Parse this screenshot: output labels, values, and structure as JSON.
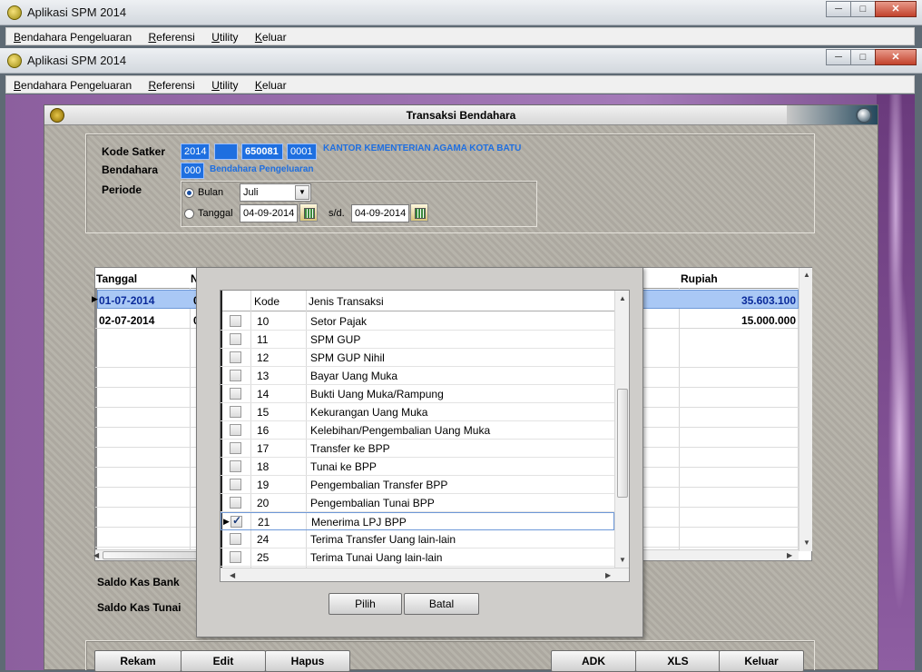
{
  "outer_window": {
    "title": "Aplikasi SPM 2014",
    "menu": [
      "Bendahara Pengeluaran",
      "Referensi",
      "Utility",
      "Keluar"
    ]
  },
  "inner_window": {
    "title": "Aplikasi SPM 2014",
    "menu": [
      "Bendahara Pengeluaran",
      "Referensi",
      "Utility",
      "Keluar"
    ]
  },
  "form": {
    "title": "Transaksi Bendahara",
    "kode_satker_label": "Kode Satker",
    "kode_satker": [
      "2014",
      "",
      "650081",
      "0001"
    ],
    "satker_name": "KANTOR KEMENTERIAN AGAMA KOTA BATU",
    "bendahara_label": "Bendahara",
    "bendahara_code": "000",
    "bendahara_name": "Bendahara Pengeluaran",
    "periode_label": "Periode",
    "bulan_label": "Bulan",
    "bulan_value": "Juli",
    "tanggal_label": "Tanggal",
    "tanggal_from": "04-09-2014",
    "sd_label": "s/d.",
    "tanggal_to": "04-09-2014"
  },
  "grid": {
    "columns": [
      "Tanggal",
      "N",
      "Rupiah"
    ],
    "rows": [
      {
        "tanggal": "01-07-2014",
        "n": "0",
        "rupiah": "35.603.100"
      },
      {
        "tanggal": "02-07-2014",
        "n": "0",
        "rupiah": "15.000.000"
      }
    ]
  },
  "saldo": {
    "bank_label": "Saldo Kas Bank",
    "tunai_label": "Saldo Kas Tunai"
  },
  "buttons": {
    "rekam": "Rekam",
    "edit": "Edit",
    "hapus": "Hapus",
    "adk": "ADK",
    "xls": "XLS",
    "keluar": "Keluar"
  },
  "dialog": {
    "col_kode": "Kode",
    "col_jenis": "Jenis Transaksi",
    "items": [
      {
        "kode": "10",
        "jenis": "Setor Pajak",
        "checked": false
      },
      {
        "kode": "11",
        "jenis": "SPM GUP",
        "checked": false
      },
      {
        "kode": "12",
        "jenis": "SPM GUP Nihil",
        "checked": false
      },
      {
        "kode": "13",
        "jenis": "Bayar Uang Muka",
        "checked": false
      },
      {
        "kode": "14",
        "jenis": "Bukti Uang Muka/Rampung",
        "checked": false
      },
      {
        "kode": "15",
        "jenis": "Kekurangan Uang Muka",
        "checked": false
      },
      {
        "kode": "16",
        "jenis": "Kelebihan/Pengembalian Uang Muka",
        "checked": false
      },
      {
        "kode": "17",
        "jenis": "Transfer ke BPP",
        "checked": false
      },
      {
        "kode": "18",
        "jenis": "Tunai ke BPP",
        "checked": false
      },
      {
        "kode": "19",
        "jenis": "Pengembalian Transfer BPP",
        "checked": false
      },
      {
        "kode": "20",
        "jenis": "Pengembalian Tunai BPP",
        "checked": false
      },
      {
        "kode": "21",
        "jenis": "Menerima LPJ BPP",
        "checked": true
      },
      {
        "kode": "24",
        "jenis": "Terima Transfer Uang lain-lain",
        "checked": false
      },
      {
        "kode": "25",
        "jenis": "Terima Tunai Uang lain-lain",
        "checked": false
      }
    ],
    "pilih": "Pilih",
    "batal": "Batal"
  }
}
